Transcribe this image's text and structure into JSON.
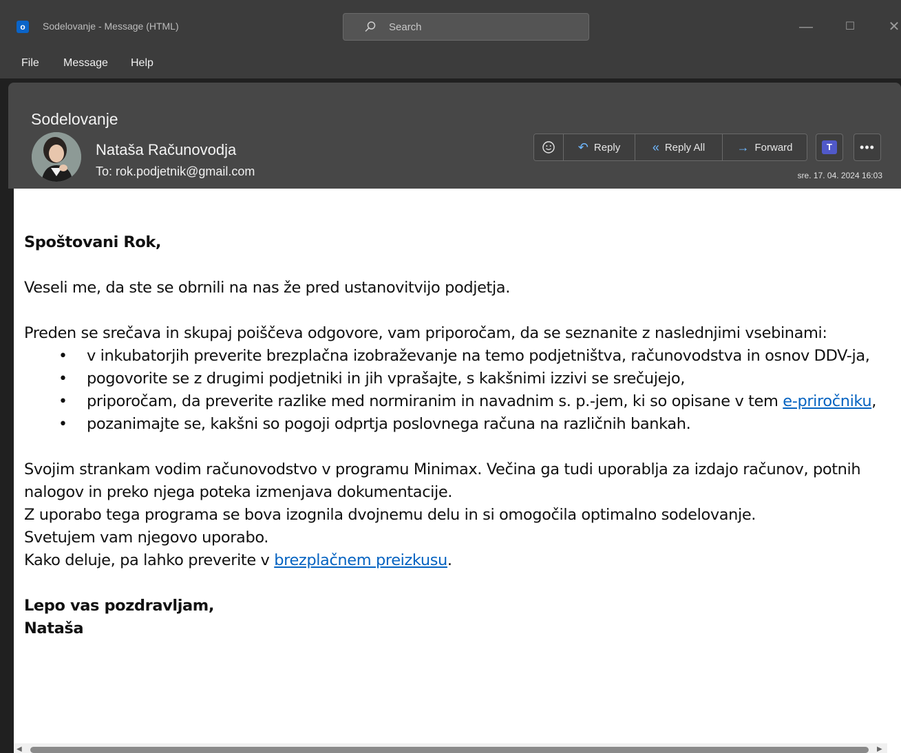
{
  "window": {
    "title": "Sodelovanje - Message (HTML)",
    "search_placeholder": "Search",
    "minimize": "—",
    "maximize": "☐",
    "close": "✕"
  },
  "menu": {
    "items": [
      "File",
      "Message",
      "Help"
    ]
  },
  "message": {
    "subject": "Sodelovanje",
    "sender": "Nataša Računovodja",
    "to": "To: rok.podjetnik@gmail.com",
    "datetime": "sre. 17. 04. 2024 16:03",
    "actions": {
      "reply": "Reply",
      "reply_all": "Reply All",
      "forward": "Forward"
    }
  },
  "body": {
    "greeting": "Spoštovani Rok,",
    "p1": "Veseli me, da ste se obrnili na nas že pred ustanovitvijo podjetja.",
    "p2": "Preden se srečava in skupaj poiščeva odgovore, vam priporočam, da se seznanite z naslednjimi vsebinami:",
    "bullets": {
      "b1": "v inkubatorjih preverite brezplačna izobraževanje na temo podjetništva, računovodstva in osnov DDV-ja,",
      "b2": "pogovorite se z drugimi podjetniki in jih vprašajte, s kakšnimi izzivi se srečujejo,",
      "b3_before": "priporočam, da preverite razlike med normiranim in navadnim s. p.-jem, ki so opisane v tem ",
      "b3_link": "e-priročniku",
      "b3_after": ",",
      "b4": "pozanimajte se, kakšni so pogoji odprtja poslovnega računa na različnih bankah."
    },
    "p3_line1": "Svojim strankam vodim računovodstvo v programu Minimax. Večina ga tudi uporablja za izdajo računov, potnih nalogov in preko njega poteka izmenjava dokumentacije.",
    "p3_line2": "Z uporabo tega programa se bova izognila dvojnemu delu in si omogočila optimalno sodelovanje.",
    "p3_line3": "Svetujem vam njegovo uporabo.",
    "p3_line4_before": "Kako deluje, pa lahko preverite v ",
    "p3_line4_link": "brezplačnem preizkusu",
    "p3_line4_after": ".",
    "closing1": "Lepo vas pozdravljam,",
    "closing2": "Nataša"
  },
  "colors": {
    "titlebar": "#3c3c3c",
    "header_panel": "#474747",
    "link": "#0563c1",
    "accent_icon": "#6fb8ff",
    "outlook_blue": "#0a64c8",
    "teams_purple": "#5059c9"
  }
}
